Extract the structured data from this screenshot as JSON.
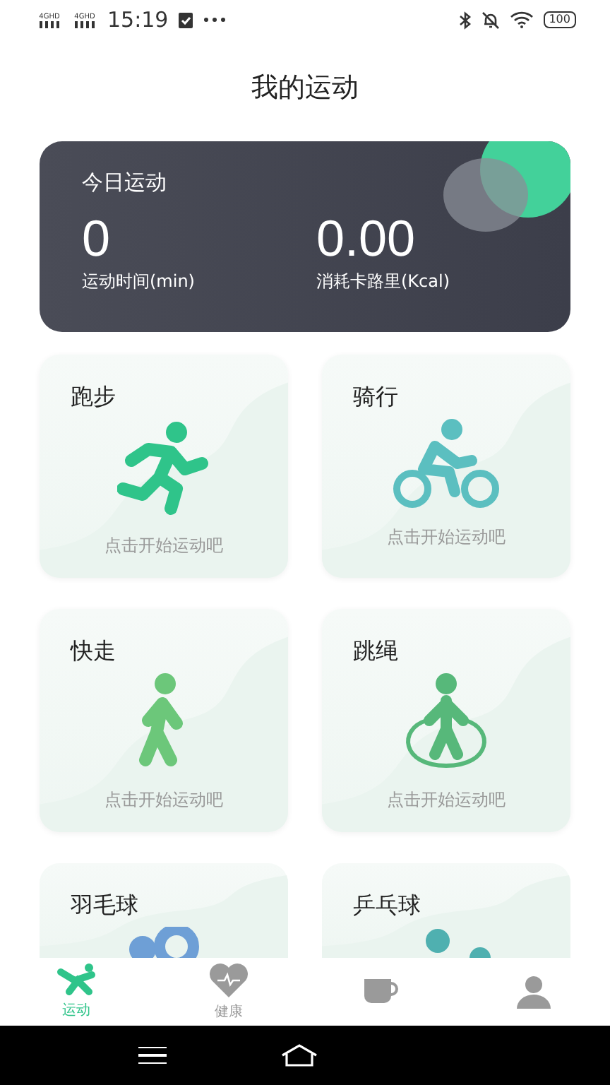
{
  "status_bar": {
    "networks": [
      "4GHD",
      "4GHD"
    ],
    "time": "15:19",
    "battery": "100"
  },
  "header": {
    "title": "我的运动"
  },
  "today": {
    "title": "今日运动",
    "stats": [
      {
        "value": "0",
        "label": "运动时间(min)"
      },
      {
        "value": "0.00",
        "label": "消耗卡路里(Kcal)"
      }
    ]
  },
  "sports": [
    {
      "kind": "run",
      "name": "跑步",
      "hint": "点击开始运动吧"
    },
    {
      "kind": "cycle",
      "name": "骑行",
      "hint": "点击开始运动吧"
    },
    {
      "kind": "walk",
      "name": "快走",
      "hint": "点击开始运动吧"
    },
    {
      "kind": "rope",
      "name": "跳绳",
      "hint": "点击开始运动吧"
    },
    {
      "kind": "badminton",
      "name": "羽毛球"
    },
    {
      "kind": "pingpong",
      "name": "乒乓球"
    }
  ],
  "tabs": [
    {
      "kind": "sport",
      "label": "运动",
      "selected": true
    },
    {
      "kind": "health",
      "label": "健康",
      "selected": false
    },
    {
      "kind": "cup",
      "selected": false
    },
    {
      "kind": "person",
      "selected": false
    }
  ]
}
